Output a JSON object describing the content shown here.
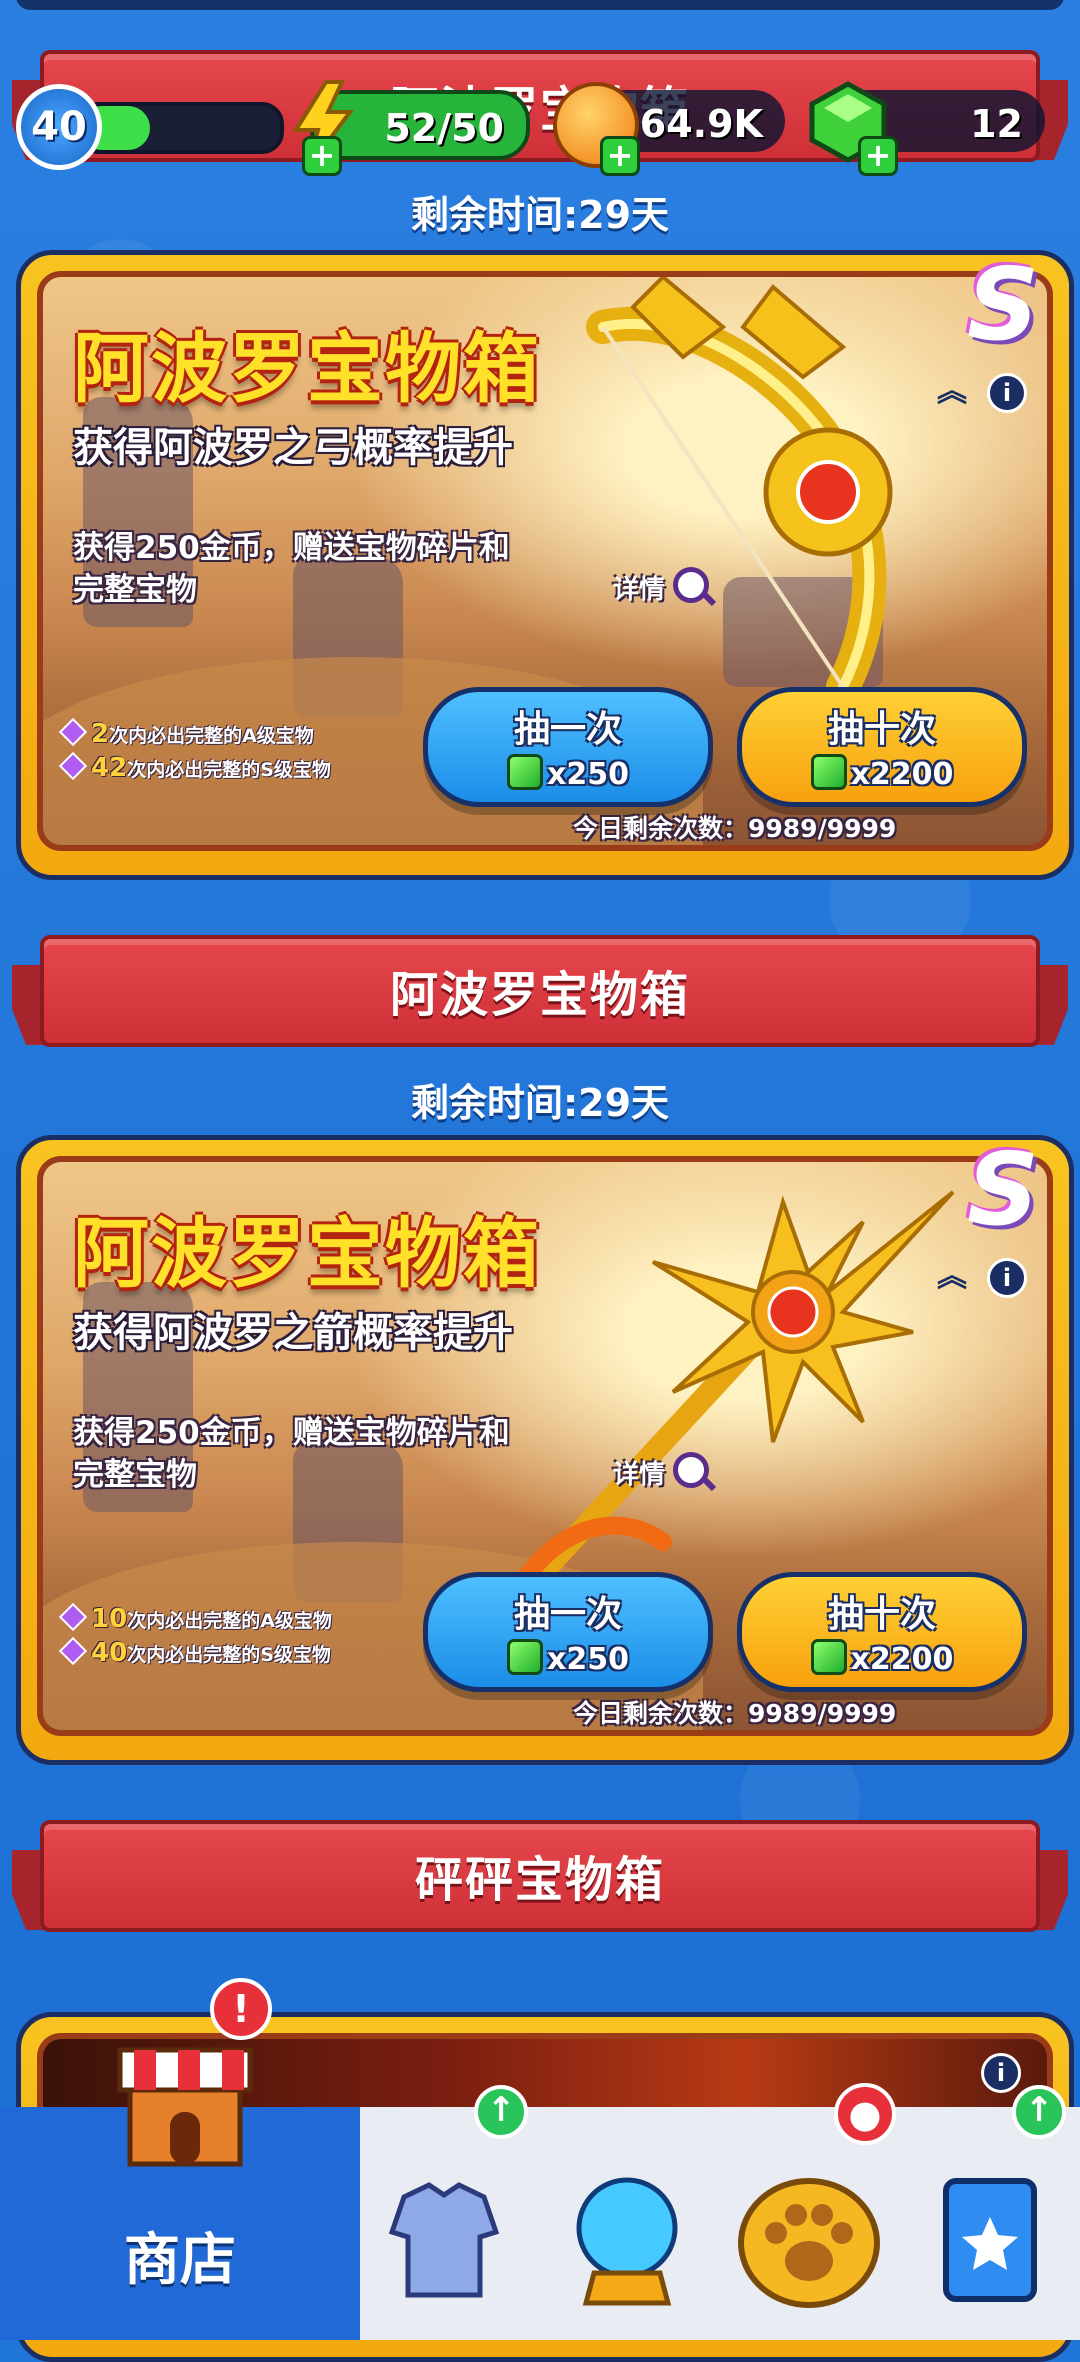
{
  "hud": {
    "level": "40",
    "level_progress": 0.35,
    "energy": "52/50",
    "coins": "64.9K",
    "gems": "12"
  },
  "sections": [
    {
      "banner_title": "阿波罗宝物箱",
      "timer": "剩余时间:29天",
      "card": {
        "title": "阿波罗宝物箱",
        "subtitle": "获得阿波罗之弓概率提升",
        "desc_line1": "获得250金币，赠送宝物碎片和",
        "desc_line2": "完整宝物",
        "detail_label": "详情",
        "pity_a_num": "2",
        "pity_a_text": "次内必出完整的A级宝物",
        "pity_s_num": "42",
        "pity_s_text": "次内必出完整的S级宝物",
        "draw_one_label": "抽一次",
        "draw_one_cost": "x250",
        "draw_ten_label": "抽十次",
        "draw_ten_cost": "x2200",
        "remaining": "今日剩余次数：9989/9999",
        "rank": "S",
        "weapon_icon": "golden-bow-icon"
      }
    },
    {
      "banner_title": "阿波罗宝物箱",
      "timer": "剩余时间:29天",
      "card": {
        "title": "阿波罗宝物箱",
        "subtitle": "获得阿波罗之箭概率提升",
        "desc_line1": "获得250金币，赠送宝物碎片和",
        "desc_line2": "完整宝物",
        "detail_label": "详情",
        "pity_a_num": "10",
        "pity_a_text": "次内必出完整的A级宝物",
        "pity_s_num": "40",
        "pity_s_text": "次内必出完整的S级宝物",
        "draw_one_label": "抽一次",
        "draw_one_cost": "x250",
        "draw_ten_label": "抽十次",
        "draw_ten_cost": "x2200",
        "remaining": "今日剩余次数：9989/9999",
        "rank": "S",
        "weapon_icon": "sun-arrow-icon"
      }
    },
    {
      "banner_title": "砰砰宝物箱"
    }
  ],
  "nav": {
    "shop_label": "商店",
    "items": [
      "armor-icon",
      "crystal-ball-icon",
      "paw-icon",
      "star-card-icon"
    ]
  },
  "colors": {
    "background": "#1f76d8",
    "banner_red": "#d9363d",
    "card_gold": "#f5b516",
    "title_yellow": "#ffe12a",
    "button_blue": "#1b8de8",
    "button_gold": "#f7a10d",
    "nav_active": "#2069d6"
  }
}
